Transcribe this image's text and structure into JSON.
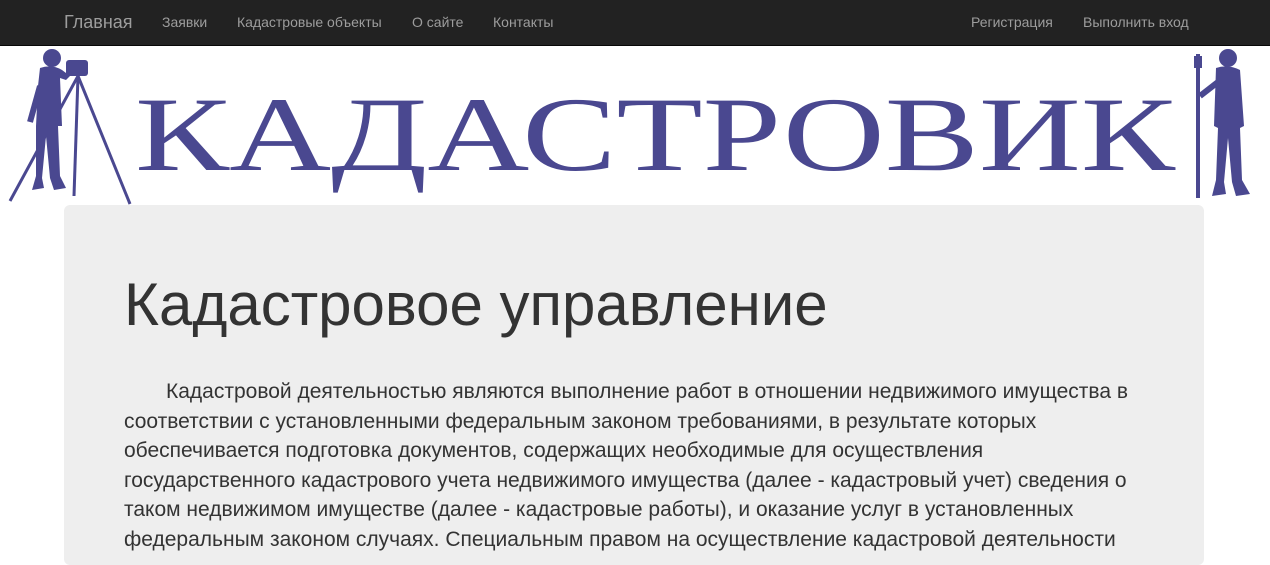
{
  "navbar": {
    "brand": "Главная",
    "left_items": [
      "Заявки",
      "Кадастровые объекты",
      "О сайте",
      "Контакты"
    ],
    "right_items": [
      "Регистрация",
      "Выполнить вход"
    ]
  },
  "banner": {
    "logo_text": "КАДАСТРОВИК",
    "color": "#4a4890"
  },
  "jumbotron": {
    "title": "Кадастровое управление",
    "text": "Кадастровой деятельностью являются выполнение работ в отношении недвижимого имущества в соответствии с установленными федеральным законом требованиями, в результате которых обеспечивается подготовка документов, содержащих необходимые для осуществления государственного кадастрового учета недвижимого имущества (далее - кадастровый учет) сведения о таком недвижимом имуществе (далее - кадастровые работы), и оказание услуг в установленных федеральным законом случаях. Специальным правом на осуществление кадастровой деятельности"
  },
  "colors": {
    "navbar_bg": "#222222",
    "nav_text": "#9d9d9d",
    "jumbotron_bg": "#eeeeee",
    "text": "#333333"
  }
}
